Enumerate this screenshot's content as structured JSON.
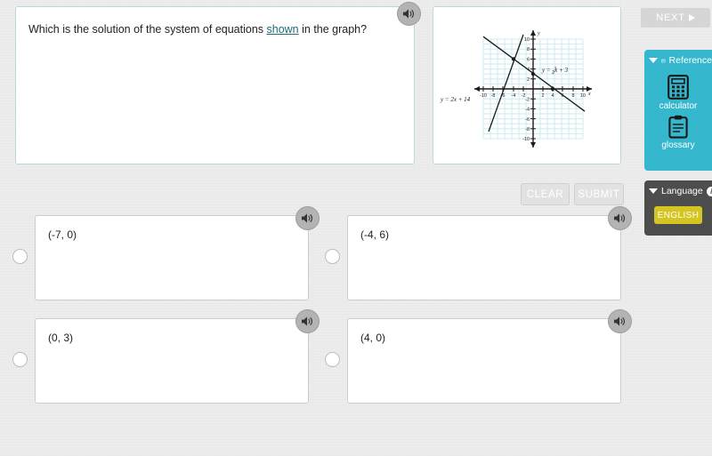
{
  "question": {
    "text_before": "Which is the solution of the system of equations ",
    "link_text": "shown",
    "text_after": " in the graph?",
    "speaker_icon": "speaker-icon"
  },
  "graph": {
    "line1_label": "y = -¾ x + 3",
    "line2_label": "y = 2x + 14",
    "x_axis_label": "x",
    "y_axis_label": "y",
    "x_ticks": [
      "-10",
      "-8",
      "-6",
      "-4",
      "-2",
      "2",
      "4",
      "6",
      "8",
      "10"
    ],
    "y_ticks": [
      "10",
      "8",
      "6",
      "4",
      "2",
      "-2",
      "-4",
      "-6",
      "-8",
      "-10"
    ],
    "grid_color": "#cfeaf0",
    "axis_color": "#1a1a1a"
  },
  "actions": {
    "clear_label": "CLEAR",
    "submit_label": "SUBMIT"
  },
  "options": [
    {
      "label": "(-7, 0)",
      "speaker_icon": "speaker-icon"
    },
    {
      "label": "(-4, 6)",
      "speaker_icon": "speaker-icon"
    },
    {
      "label": "(0, 3)",
      "speaker_icon": "speaker-icon"
    },
    {
      "label": "(4, 0)",
      "speaker_icon": "speaker-icon"
    }
  ],
  "sidebar": {
    "next_label": "NEXT",
    "reference": {
      "title": "Reference",
      "header_icon": "book-icon",
      "caret_icon": "caret-down-icon",
      "tools": [
        {
          "label": "calculator",
          "icon": "calculator-icon"
        },
        {
          "label": "glossary",
          "icon": "clipboard-icon"
        }
      ]
    },
    "language": {
      "title": "Language",
      "caret_icon": "caret-down-icon",
      "info_icon": "info-icon",
      "info_glyph": "i",
      "current_label": "ENGLISH"
    }
  },
  "colors": {
    "accent_cyan": "#35b8ce",
    "panel_dark": "#4d4d4d",
    "english_yellow": "#d4c520",
    "panel_border": "#b8dade",
    "page_bg": "#ededed"
  }
}
